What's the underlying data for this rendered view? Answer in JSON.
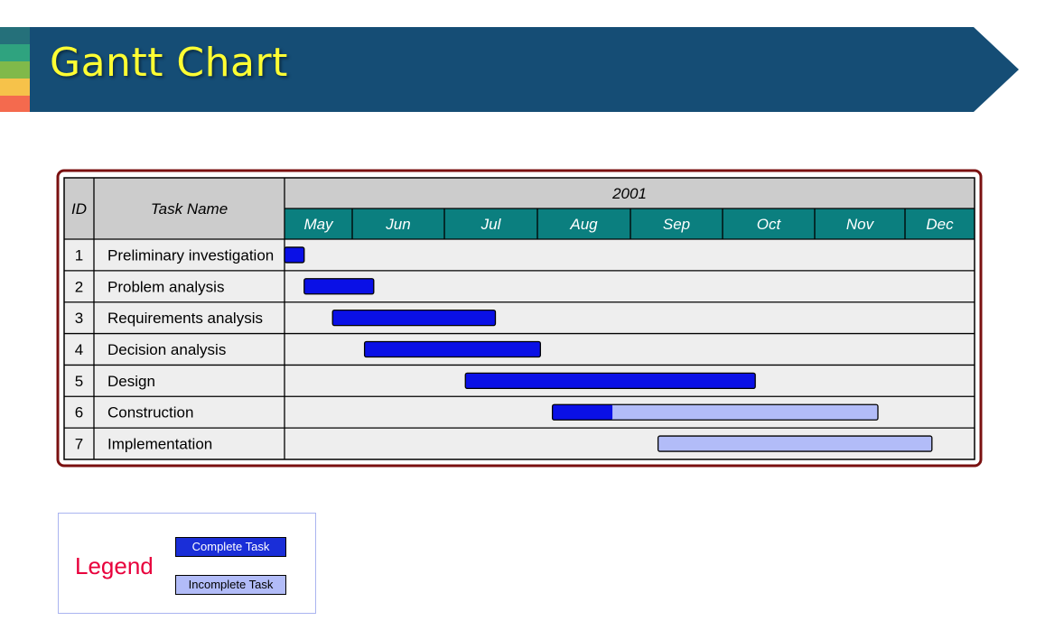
{
  "header": {
    "title": "Gantt Chart"
  },
  "chart_data": {
    "type": "gantt",
    "year": "2001",
    "headers": {
      "id": "ID",
      "task_name": "Task Name"
    },
    "months": [
      "May",
      "Jun",
      "Jul",
      "Aug",
      "Sep",
      "Oct",
      "Nov",
      "Dec"
    ],
    "tasks": [
      {
        "id": "1",
        "name": "Preliminary investigation",
        "start": "2001-05-01",
        "end": "2001-05-10",
        "complete_until": "2001-05-10"
      },
      {
        "id": "2",
        "name": "Problem analysis",
        "start": "2001-05-10",
        "end": "2001-06-08",
        "complete_until": "2001-06-08"
      },
      {
        "id": "3",
        "name": "Requirements analysis",
        "start": "2001-05-23",
        "end": "2001-07-18",
        "complete_until": "2001-07-18"
      },
      {
        "id": "4",
        "name": "Decision analysis",
        "start": "2001-06-05",
        "end": "2001-08-02",
        "complete_until": "2001-08-02"
      },
      {
        "id": "5",
        "name": "Design",
        "start": "2001-07-08",
        "end": "2001-10-12",
        "complete_until": "2001-10-12"
      },
      {
        "id": "6",
        "name": "Construction",
        "start": "2001-08-06",
        "end": "2001-11-22",
        "complete_until": "2001-08-26"
      },
      {
        "id": "7",
        "name": "Implementation",
        "start": "2001-09-10",
        "end": "2001-12-13",
        "complete_until": null
      }
    ],
    "colors": {
      "complete": "#0a10e6",
      "incomplete": "#b2bcf8",
      "header_bg": "#cccccc",
      "month_bg": "#0b7f7f",
      "row_bg": "#eeeeee",
      "frame": "#7a1010"
    }
  },
  "legend": {
    "label": "Legend",
    "complete": "Complete Task",
    "incomplete": "Incomplete Task"
  }
}
